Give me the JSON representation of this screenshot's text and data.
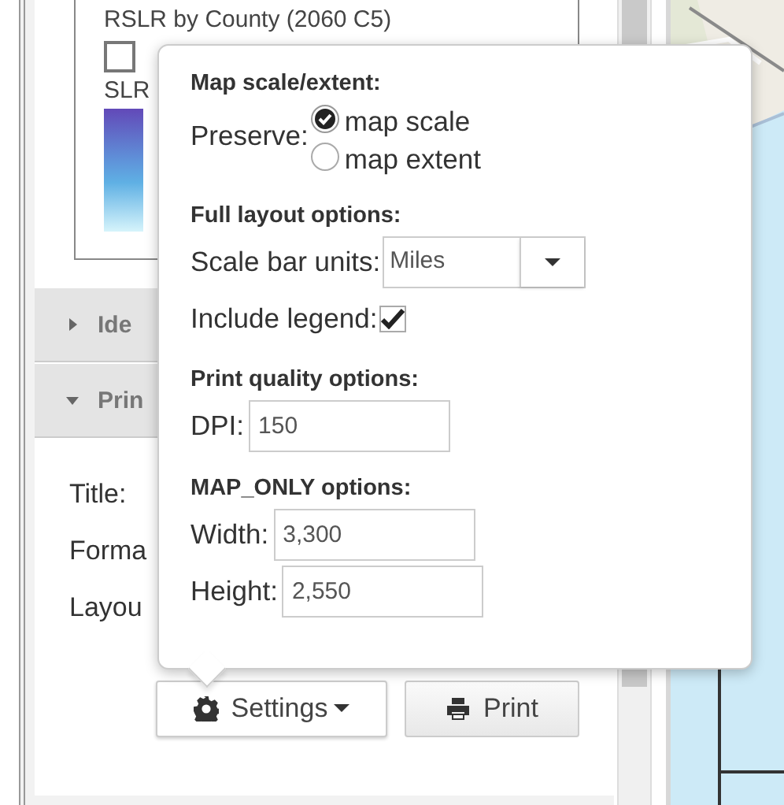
{
  "legend": {
    "layer_title": "RSLR by County (2060 C5)",
    "symbol_label": "SLR"
  },
  "sections": [
    {
      "title": "Ide",
      "expanded": false
    },
    {
      "title": "Prin",
      "expanded": true
    }
  ],
  "print_form": {
    "labels": [
      "Title:",
      "Forma",
      "Layou"
    ]
  },
  "buttons": [
    {
      "kind": "settings",
      "label": "Settings"
    },
    {
      "kind": "print",
      "label": "Print"
    }
  ],
  "settings_popup": {
    "groups": [
      {
        "heading": "Map scale/extent:",
        "fields": [
          {
            "kind": "radio",
            "label": "Preserve:",
            "options": [
              {
                "label": "map scale",
                "selected": true
              },
              {
                "label": "map extent",
                "selected": false
              }
            ]
          }
        ]
      },
      {
        "heading": "Full layout options:",
        "fields": [
          {
            "kind": "select",
            "label": "Scale bar units:",
            "value": "Miles"
          },
          {
            "kind": "checkbox",
            "label": "Include legend:",
            "checked": true
          }
        ]
      },
      {
        "heading": "Print quality options:",
        "fields": [
          {
            "kind": "input",
            "label": "DPI:",
            "value": "150"
          }
        ]
      },
      {
        "heading": "MAP_ONLY options:",
        "fields": [
          {
            "kind": "input",
            "label": "Width:",
            "value": "3,300"
          },
          {
            "kind": "input",
            "label": "Height:",
            "value": "2,550"
          }
        ]
      }
    ]
  }
}
